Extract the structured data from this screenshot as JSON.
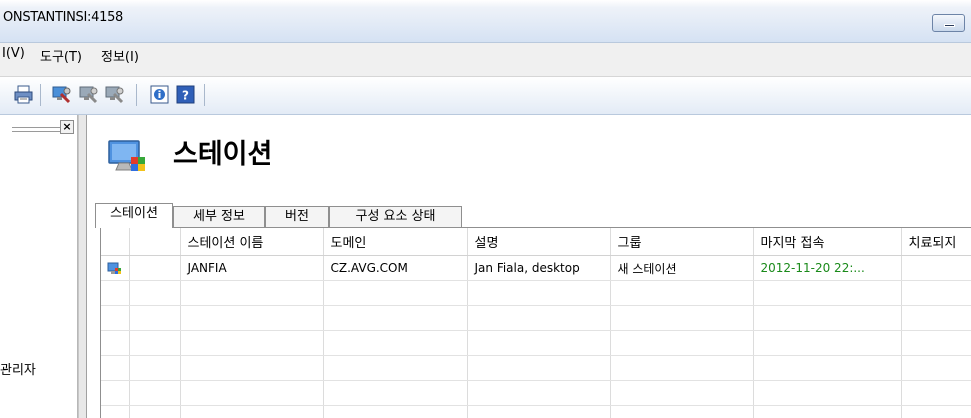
{
  "window": {
    "title": "ONSTANTINSI:4158"
  },
  "menu": {
    "items": [
      {
        "label": "I(V)"
      },
      {
        "label": "도구(T)"
      },
      {
        "label": "정보(I)"
      }
    ]
  },
  "toolbar": {
    "icons": [
      "printer-icon",
      "station-tool-icon",
      "station-tool-icon",
      "station-tool-icon",
      "info-icon",
      "help-icon"
    ]
  },
  "left_pane": {
    "admin_label": "관리자"
  },
  "page": {
    "title": "스테이션"
  },
  "tabs": [
    {
      "label": "스테이션",
      "active": true
    },
    {
      "label": "세부 정보",
      "active": false
    },
    {
      "label": "버전",
      "active": false
    },
    {
      "label": "구성 요소 상태",
      "active": false
    }
  ],
  "table": {
    "columns": [
      "",
      "",
      "스테이션 이름",
      "도메인",
      "설명",
      "그룹",
      "마지막 접속",
      "치료되지"
    ],
    "rows": [
      {
        "icon": "station-icon",
        "name": "JANFIA",
        "domain": "CZ.AVG.COM",
        "description": "Jan Fiala, desktop",
        "group": "새 스테이션",
        "last_contact": "2012-11-20 22:...",
        "cured": ""
      }
    ]
  },
  "colors": {
    "last_contact": "#1a8a1a",
    "titlebar": "#d5e2f3"
  }
}
